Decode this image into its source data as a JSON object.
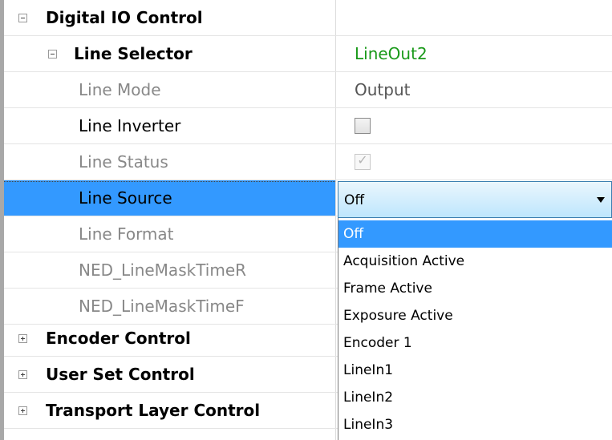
{
  "tree": {
    "rows": [
      {
        "name": "Digital IO Control",
        "value": ""
      },
      {
        "name": "Line Selector",
        "value": "LineOut2"
      },
      {
        "name": "Line Mode",
        "value": "Output"
      },
      {
        "name": "Line Inverter",
        "value": ""
      },
      {
        "name": "Line Status",
        "value": ""
      },
      {
        "name": "Line Source",
        "value": ""
      },
      {
        "name": "Line Format",
        "value": ""
      },
      {
        "name": "NED_LineMaskTimeR",
        "value": ""
      },
      {
        "name": "NED_LineMaskTimeF",
        "value": ""
      },
      {
        "name": "Encoder Control",
        "value": ""
      },
      {
        "name": "User Set Control",
        "value": ""
      },
      {
        "name": "Transport Layer Control",
        "value": ""
      }
    ],
    "line_inverter_checked": false,
    "line_status_checked": true,
    "value_color": "#1a9a1a",
    "selection_color": "#3399ff"
  },
  "combo": {
    "selected": "Off",
    "options": [
      "Off",
      "Acquisition Active",
      "Frame Active",
      "Exposure Active",
      "Encoder 1",
      "LineIn1",
      "LineIn2",
      "LineIn3"
    ]
  }
}
